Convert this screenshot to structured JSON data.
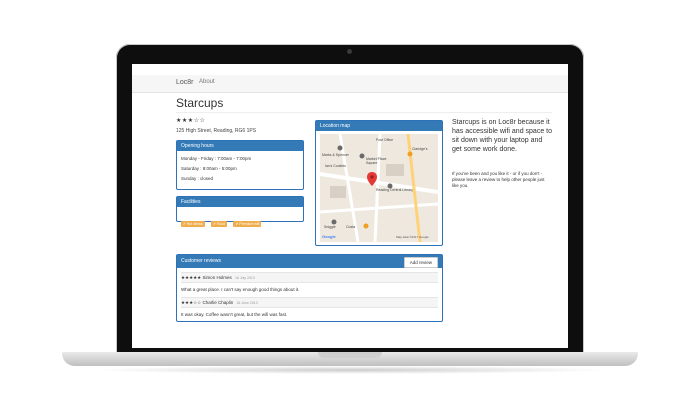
{
  "nav": {
    "brand": "Loc8r",
    "about": "About"
  },
  "location": {
    "name": "Starcups",
    "rating_stars": "★★★☆☆",
    "address": "125 High Street, Reading, RG6 1PS"
  },
  "opening_hours": {
    "title": "Opening hours",
    "lines": [
      "Monday - Friday : 7:00am - 7:00pm",
      "Saturday : 8:00am - 5:00pm",
      "Sunday : closed"
    ]
  },
  "facilities": {
    "title": "Facilities",
    "items": [
      "✔ Hot drinks",
      "✔ Food",
      "✔ Premium wifi"
    ]
  },
  "map": {
    "title": "Location map",
    "labels": [
      "Marks & Spencer",
      "Ian's Cookies",
      "Market Place Square",
      "Post Office",
      "Reading Central Library",
      "Sniggle",
      "Costa",
      "Google",
      "Map data ©2017 Google",
      "Claridge's"
    ]
  },
  "sidebar": {
    "headline": "Starcups is on Loc8r because it has accessible wifi and space to sit down with your laptop and get some work done.",
    "note": "If you've been and you like it - or if you don't - please leave a review to help other people just like you."
  },
  "reviews": {
    "title": "Customer reviews",
    "add_label": "Add review",
    "items": [
      {
        "stars": "★★★★★",
        "author": "Simon Holmes",
        "date": "16 July 2013",
        "text": "What a great place. I can't say enough good things about it."
      },
      {
        "stars": "★★★☆☆",
        "author": "Charlie Chaplin",
        "date": "16 June 2013",
        "text": "It was okay. Coffee wasn't great, but the wifi was fast."
      }
    ]
  },
  "colors": {
    "panel_header": "#337ab7",
    "badge": "#f0ad4e",
    "map_pin": "#e53935"
  }
}
